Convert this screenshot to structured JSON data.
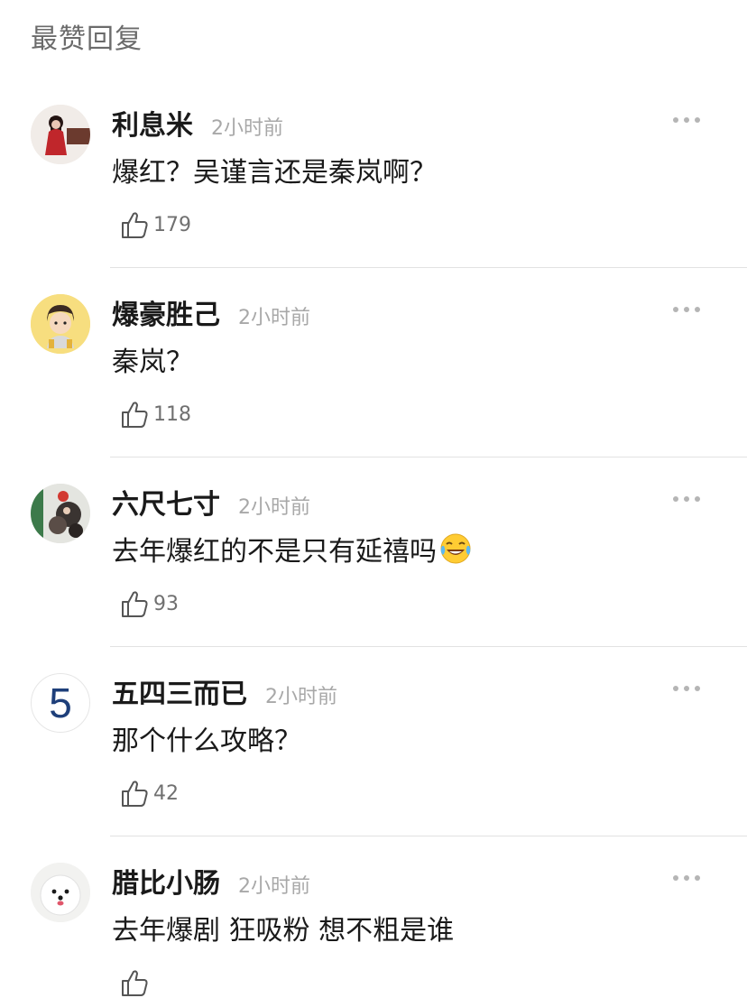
{
  "section": {
    "title": "最赞回复"
  },
  "comments": [
    {
      "username": "利息米",
      "time": "2小时前",
      "text": "爆红？吴谨言还是秦岚啊？",
      "likes": "179",
      "avatar_icon": "red-dress-photo-avatar"
    },
    {
      "username": "爆豪胜己",
      "time": "2小时前",
      "text": "秦岚？",
      "likes": "118",
      "avatar_icon": "cartoon-boy-avatar"
    },
    {
      "username": "六尺七寸",
      "time": "2小时前",
      "text": "去年爆红的不是只有延禧吗",
      "likes": "93",
      "avatar_icon": "christmas-photo-avatar",
      "emoji": "laughing-tears-emoji"
    },
    {
      "username": "五四三而已",
      "time": "2小时前",
      "text": "那个什么攻略？",
      "likes": "42",
      "avatar_icon": "number-avatar",
      "avatar_text": "5"
    },
    {
      "username": "腊比小肠",
      "time": "2小时前",
      "text": "去年爆剧 狂吸粉 想不粗是谁",
      "likes": "",
      "avatar_icon": "white-dog-avatar"
    }
  ]
}
